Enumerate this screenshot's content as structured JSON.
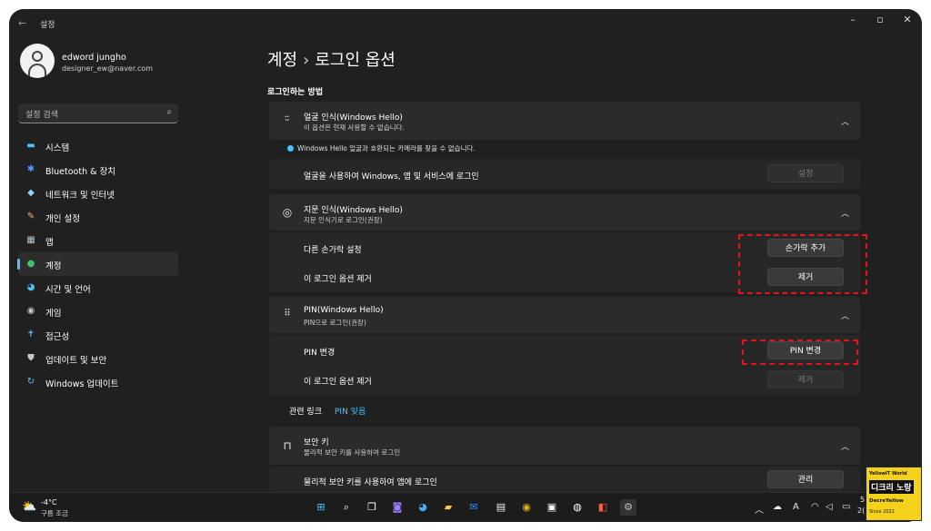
{
  "window": {
    "back": "←",
    "title": "설정",
    "controls": [
      "–",
      "▫",
      "✕"
    ]
  },
  "profile": {
    "name": "edword jungho",
    "email": "designer_ew@naver.com"
  },
  "search": {
    "placeholder": "설정 검색"
  },
  "nav": [
    {
      "label": "시스템",
      "icon": "monitor-icon",
      "glyph": "▬",
      "color": "#4cc2ff"
    },
    {
      "label": "Bluetooth & 장치",
      "icon": "bluetooth-icon",
      "glyph": "✱",
      "color": "#4c9bff"
    },
    {
      "label": "네트워크 및 인터넷",
      "icon": "wifi-icon",
      "glyph": "◆",
      "color": "#8fd3ff"
    },
    {
      "label": "개인 설정",
      "icon": "brush-icon",
      "glyph": "✎",
      "color": "#f0b27a"
    },
    {
      "label": "앱",
      "icon": "apps-icon",
      "glyph": "▦",
      "color": "#b8c4d0"
    },
    {
      "label": "계정",
      "icon": "person-icon",
      "glyph": "●",
      "color": "#3ec46d"
    },
    {
      "label": "시간 및 언어",
      "icon": "globe-clock-icon",
      "glyph": "◕",
      "color": "#4cc2ff"
    },
    {
      "label": "게임",
      "icon": "gamepad-icon",
      "glyph": "◉",
      "color": "#c8c8c8"
    },
    {
      "label": "접근성",
      "icon": "accessibility-icon",
      "glyph": "✝",
      "color": "#4cc2ff"
    },
    {
      "label": "업데이트 및 보안",
      "icon": "shield-icon",
      "glyph": "⛊",
      "color": "#c8c8c8"
    },
    {
      "label": "Windows 업데이트",
      "icon": "windows-update-icon",
      "glyph": "↻",
      "color": "#4cc2ff"
    }
  ],
  "active_nav": "계정",
  "accent": "#4cc2ff",
  "main": {
    "breadcrumb": {
      "parent": "계정",
      "sep": "›",
      "current": "로그인 옵션"
    },
    "section_title": "로그인하는 방법",
    "face": {
      "title": "얼굴 인식(Windows Hello)",
      "subtitle": "이 옵션은 현재 사용할 수 없습니다.",
      "info": "Windows Hello 얼굴과 호환되는 카메라를 찾을 수 없습니다.",
      "row_label": "얼굴을 사용하여 Windows, 앱 및 서비스에 로그인",
      "row_button": "설정"
    },
    "fingerprint": {
      "title": "지문 인식(Windows Hello)",
      "subtitle": "지문 인식기로 로그인(권장)",
      "row1_label": "다른 손가락 설정",
      "row1_button": "손가락 추가",
      "row2_label": "이 로그인 옵션 제거",
      "row2_button": "제거"
    },
    "pin": {
      "title": "PIN(Windows Hello)",
      "subtitle": "PIN으로 로그인(권장)",
      "row1_label": "PIN 변경",
      "row1_button": "PIN 변경",
      "row2_label": "이 로그인 옵션 제거",
      "row2_button": "제거"
    },
    "related": {
      "label": "관련 링크",
      "link": "PIN 잊음"
    },
    "security_key": {
      "title": "보안 키",
      "subtitle": "물리적 보안 키를 사용하여 로그인",
      "row_label": "물리적 보안 키를 사용하여 앱에 로그인",
      "row_button": "관리"
    }
  },
  "taskbar": {
    "temp": "-4°C",
    "condition": "구름 조금",
    "tray_lang": "A",
    "clock_partial": [
      "5",
      "2("
    ]
  },
  "watermark": {
    "line1": "YellowIT World",
    "line2": "디크리 노랑",
    "line3": "DecreYellow",
    "line4": "Since 2021"
  }
}
